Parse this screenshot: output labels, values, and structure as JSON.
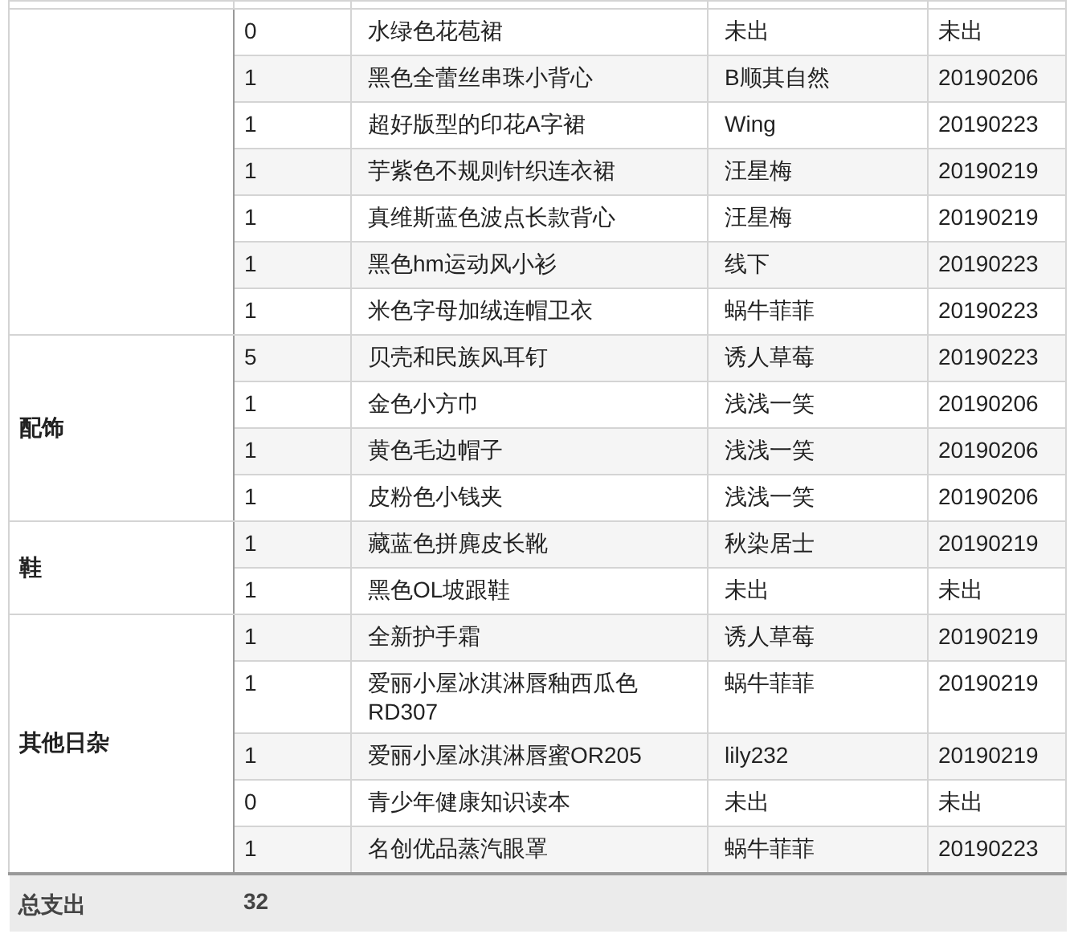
{
  "groups": [
    {
      "rows": [
        {
          "qty": "0",
          "item": "水绿色花苞裙",
          "seller": "未出",
          "date": "未出"
        },
        {
          "qty": "1",
          "item": "黑色全蕾丝串珠小背心",
          "seller": "B顺其自然",
          "date": "20190206"
        },
        {
          "qty": "1",
          "item": "超好版型的印花A字裙",
          "seller": "Wing",
          "date": "20190223"
        },
        {
          "qty": "1",
          "item": "芋紫色不规则针织连衣裙",
          "seller": "汪星梅",
          "date": "20190219"
        },
        {
          "qty": "1",
          "item": "真维斯蓝色波点长款背心",
          "seller": "汪星梅",
          "date": "20190219"
        },
        {
          "qty": "1",
          "item": "黑色hm运动风小衫",
          "seller": "线下",
          "date": "20190223"
        },
        {
          "qty": "1",
          "item": "米色字母加绒连帽卫衣",
          "seller": "蜗牛菲菲",
          "date": "20190223"
        }
      ]
    },
    {
      "category": "配饰",
      "rows": [
        {
          "qty": "5",
          "item": "贝壳和民族风耳钉",
          "seller": "诱人草莓",
          "date": "20190223"
        },
        {
          "qty": "1",
          "item": "金色小方巾",
          "seller": "浅浅一笑",
          "date": "20190206"
        },
        {
          "qty": "1",
          "item": "黄色毛边帽子",
          "seller": "浅浅一笑",
          "date": "20190206"
        },
        {
          "qty": "1",
          "item": "皮粉色小钱夹",
          "seller": "浅浅一笑",
          "date": "20190206"
        }
      ]
    },
    {
      "category": "鞋",
      "rows": [
        {
          "qty": "1",
          "item": "藏蓝色拼麂皮长靴",
          "seller": "秋染居士",
          "date": "20190219"
        },
        {
          "qty": "1",
          "item": "黑色OL坡跟鞋",
          "seller": "未出",
          "date": "未出"
        }
      ]
    },
    {
      "category": "其他日杂",
      "rows": [
        {
          "qty": "1",
          "item": "全新护手霜",
          "seller": "诱人草莓",
          "date": "20190219"
        },
        {
          "qty": "1",
          "item": "爱丽小屋冰淇淋唇釉西瓜色RD307",
          "seller": "蜗牛菲菲",
          "date": "20190219"
        },
        {
          "qty": "1",
          "item": "爱丽小屋冰淇淋唇蜜OR205",
          "seller": "lily232",
          "date": "20190219"
        },
        {
          "qty": "0",
          "item": "青少年健康知识读本",
          "seller": "未出",
          "date": "未出"
        },
        {
          "qty": "1",
          "item": "名创优品蒸汽眼罩",
          "seller": "蜗牛菲菲",
          "date": "20190223"
        }
      ]
    }
  ],
  "total": {
    "label": "总支出",
    "value": "32"
  }
}
